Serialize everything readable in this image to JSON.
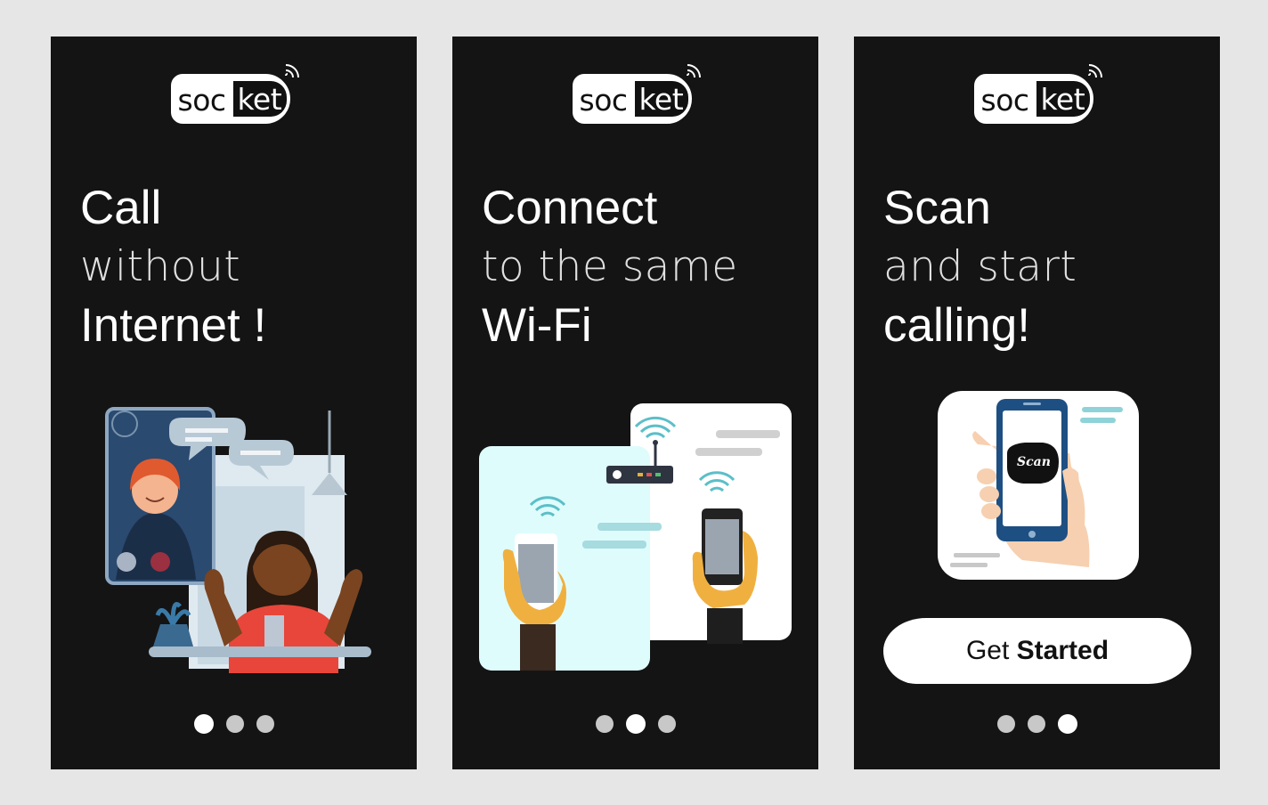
{
  "logo": {
    "part1": "soc",
    "part2": "ket"
  },
  "screens": [
    {
      "line1": "Call",
      "line2": "without",
      "line3": "Internet !",
      "active_dot": 0
    },
    {
      "line1": "Connect",
      "line2": "to the same",
      "line3": "Wi-Fi",
      "active_dot": 1
    },
    {
      "line1": "Scan",
      "line2": "and start",
      "line3": "calling!",
      "active_dot": 2,
      "scan_bubble": "Scan",
      "button": {
        "prefix": "Get",
        "bold": "Started"
      }
    }
  ],
  "colors": {
    "screen_bg": "#141414",
    "page_bg": "#e6e6e6",
    "accent_blue": "#1e4f82",
    "wifi_teal": "#5bbfc8"
  }
}
